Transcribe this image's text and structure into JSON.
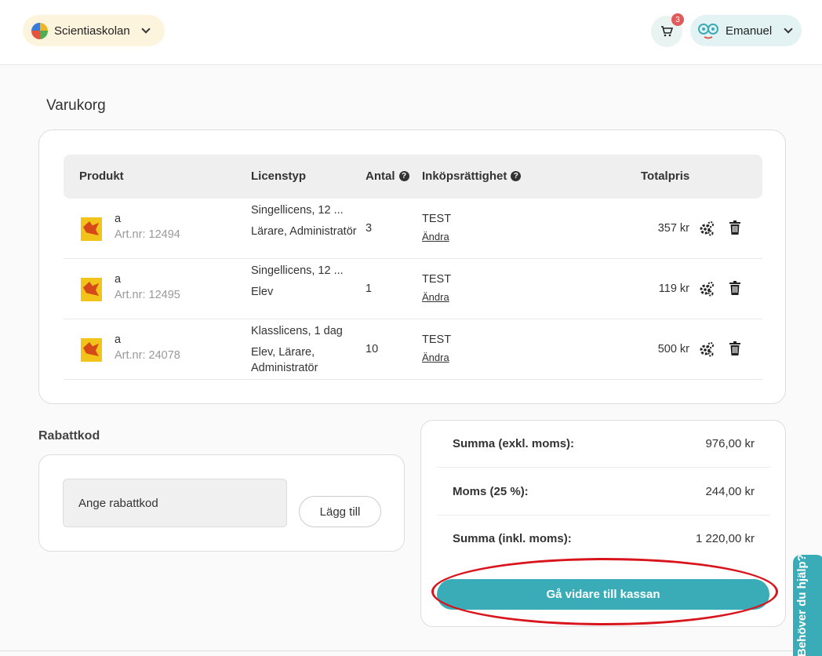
{
  "header": {
    "school": "Scientiaskolan",
    "cart_count": "3",
    "user": "Emanuel"
  },
  "page_title": "Varukorg",
  "table": {
    "headers": [
      "Produkt",
      "Licenstyp",
      "Antal",
      "Inköpsrättighet",
      "Totalpris"
    ],
    "rows": [
      {
        "name": "a",
        "art": "Art.nr: 12494",
        "license": "Singellicens, 12 ...",
        "roles": "Lärare, Administratör",
        "qty": "3",
        "permission": "TEST",
        "change": "Ändra",
        "price": "357 kr"
      },
      {
        "name": "a",
        "art": "Art.nr: 12495",
        "license": "Singellicens, 12 ...",
        "roles": "Elev",
        "qty": "1",
        "permission": "TEST",
        "change": "Ändra",
        "price": "119 kr"
      },
      {
        "name": "a",
        "art": "Art.nr: 24078",
        "license": "Klasslicens, 1 dag",
        "roles": "Elev, Lärare, Administratör",
        "qty": "10",
        "permission": "TEST",
        "change": "Ändra",
        "price": "500 kr"
      }
    ]
  },
  "discount": {
    "title": "Rabattkod",
    "placeholder": "Ange rabattkod",
    "button": "Lägg till"
  },
  "summary": {
    "excl_label": "Summa (exkl. moms):",
    "excl_value": "976,00 kr",
    "vat_label": "Moms (25 %):",
    "vat_value": "244,00 kr",
    "incl_label": "Summa (inkl. moms):",
    "incl_value": "1 220,00 kr",
    "checkout": "Gå vidare till kassan"
  },
  "help": "Behöver du hjälp?",
  "colors": {
    "accent": "#3aacb7",
    "highlight": "#d8141c",
    "badge": "#e05a5a"
  }
}
